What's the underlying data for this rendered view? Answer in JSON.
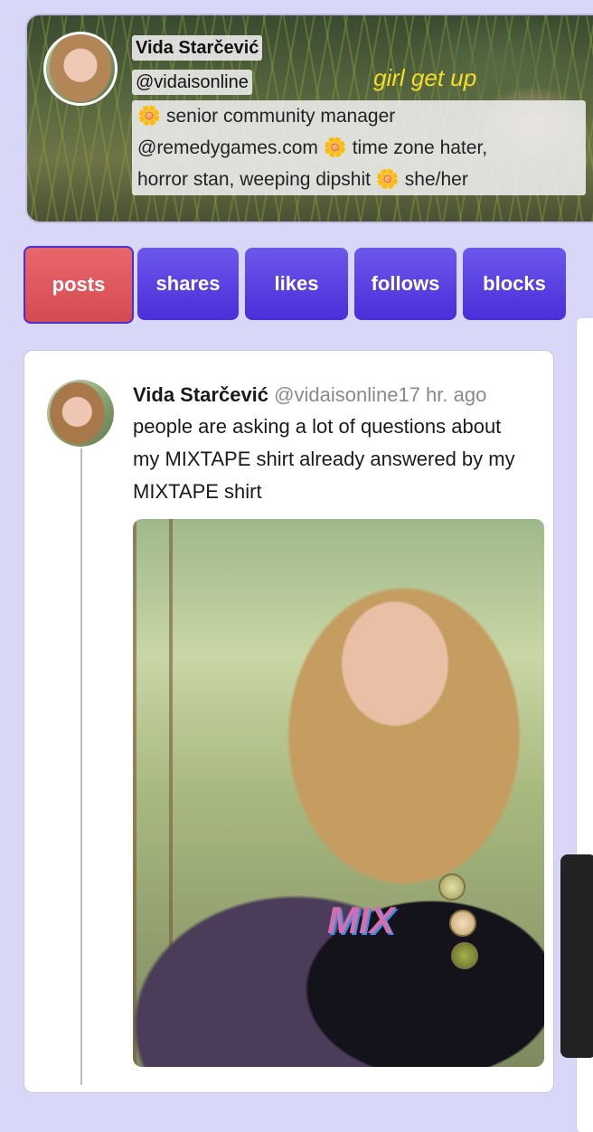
{
  "profile": {
    "display_name": "Vida Starčević",
    "handle": "@vidaisonline",
    "tagline": "girl get up",
    "bio_lines": [
      "🌼 senior community manager",
      "@remedygames.com 🌼 time zone hater,",
      "horror stan, weeping dipshit 🌼 she/her"
    ]
  },
  "tabs": [
    {
      "label": "posts",
      "active": true
    },
    {
      "label": "shares",
      "active": false
    },
    {
      "label": "likes",
      "active": false
    },
    {
      "label": "follows",
      "active": false
    },
    {
      "label": "blocks",
      "active": false
    }
  ],
  "post": {
    "author_name": "Vida Starčević",
    "author_handle": "@vidaisonline",
    "time": "17 hr. ago",
    "text": "people are asking a lot of questions about my MIXTAPE shirt already answered by my MIXTAPE shirt",
    "image_shirt_text": "MIX"
  },
  "colors": {
    "background": "#d9d7f7",
    "tab": "#5a3fe0",
    "tab_active": "#e05a60",
    "tagline": "#f5de27",
    "flower": "#f2a92c"
  }
}
